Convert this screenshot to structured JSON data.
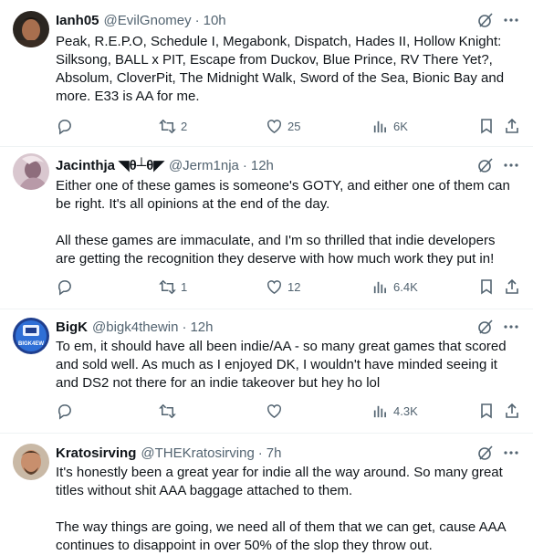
{
  "colors": {
    "text": "#0f1419",
    "muted": "#536471",
    "divider": "#eff3f4"
  },
  "tweets": [
    {
      "name": "Ianh05",
      "handle": "@EvilGnomey",
      "sep": "·",
      "time": "10h",
      "text": "Peak, R.E.P.O, Schedule I, Megabonk, Dispatch, Hades II, Hollow Knight:\nSilksong, BALL x PIT, Escape from Duckov, Blue Prince, RV There Yet?,\nAbsolum, CloverPit, The Midnight Walk, Sword of the Sea, Bionic Bay and\nmore. E33 is AA for me.",
      "replies": "",
      "reposts": "2",
      "likes": "25",
      "views": "6K"
    },
    {
      "name": "Jacinthja",
      "name_glyphs": "◥θ┴θ◤",
      "handle": "@Jerm1nja",
      "sep": "·",
      "time": "12h",
      "text": "Either one of these games is someone's GOTY, and either one of them can\nbe right. It's all opinions at the end of the day.\n\nAll these games are immaculate, and I'm so thrilled that indie developers\nare getting the recognition they deserve with how much work they put in!",
      "replies": "",
      "reposts": "1",
      "likes": "12",
      "views": "6.4K"
    },
    {
      "name": "BigK",
      "handle": "@bigk4thewin",
      "sep": "·",
      "time": "12h",
      "avatar_text": "BIGK4EW",
      "text": "To em, it should have all been indie/AA - so many great games that scored\nand sold well. As much as I enjoyed DK, I wouldn't have minded seeing it\nand DS2 not there for an indie takeover but hey ho lol",
      "replies": "",
      "reposts": "",
      "likes": "",
      "views": "4.3K"
    },
    {
      "name": "Kratosirving",
      "handle": "@THEKratosirving",
      "sep": "·",
      "time": "7h",
      "text": "It's honestly been a great year for indie all the way around. So many great\ntitles without shit AAA baggage attached to them.\n\nThe way things are going, we need all of them that we can get, cause AAA\ncontinues to disappoint in over 50% of the slop they throw out."
    }
  ]
}
